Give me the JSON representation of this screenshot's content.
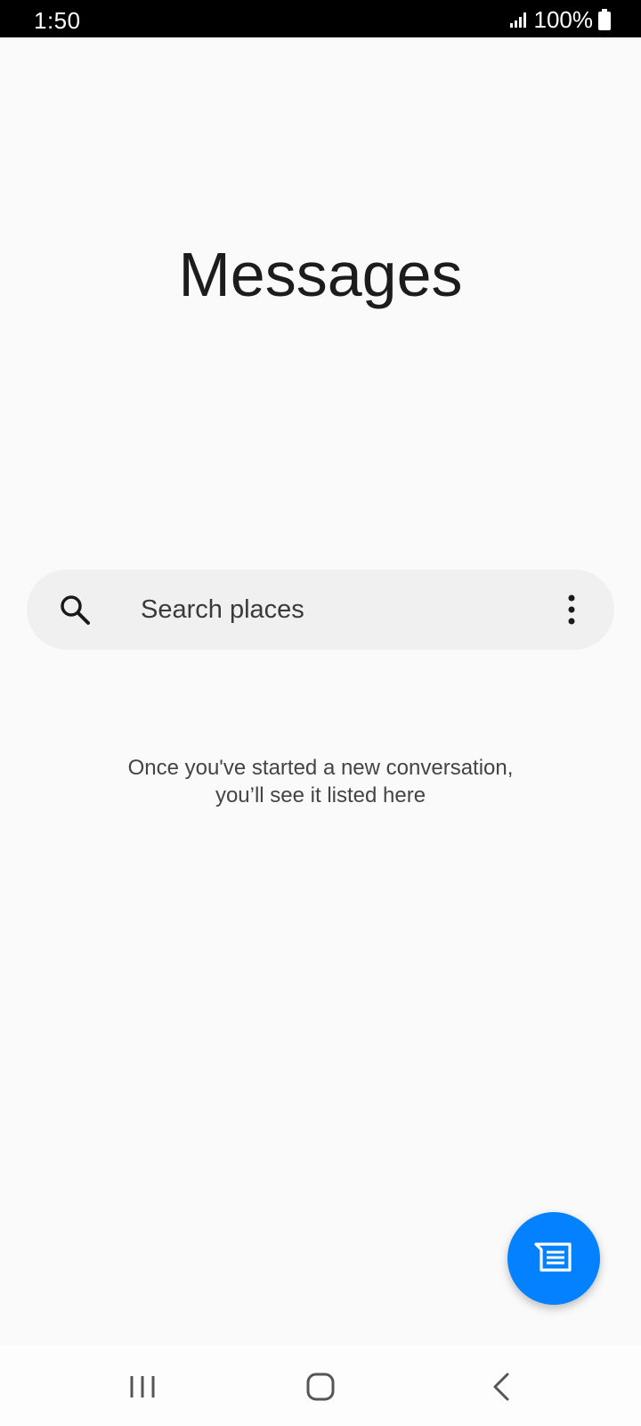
{
  "status_bar": {
    "time": "1:50",
    "battery": "100%"
  },
  "header": {
    "title": "Messages"
  },
  "search": {
    "placeholder": "Search places"
  },
  "empty_state": {
    "line1": "Once you've started a new conversation,",
    "line2": "you’ll see it listed here"
  },
  "icons": {
    "search": "search-icon",
    "more": "more-vert-icon",
    "compose": "compose-message-icon",
    "recents": "recents-icon",
    "home": "home-icon",
    "back": "back-icon"
  },
  "colors": {
    "accent": "#0381fe",
    "background": "#fafafa",
    "search_bg": "#f0f0f0"
  }
}
